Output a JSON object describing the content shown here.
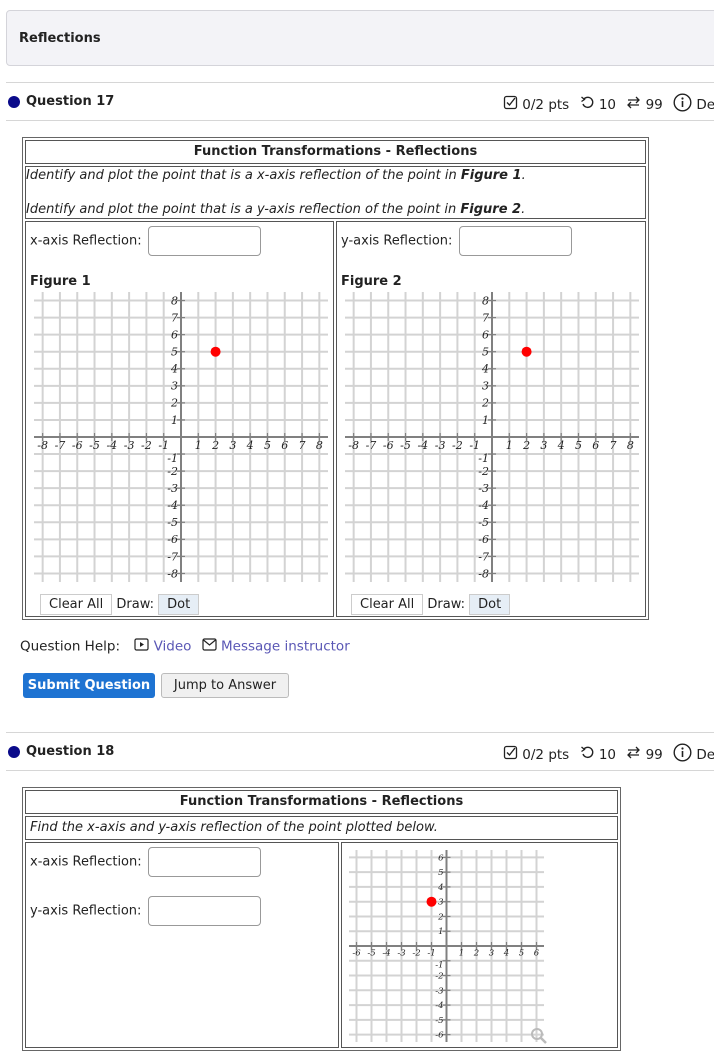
{
  "page": {
    "title": "Reflections"
  },
  "questions": [
    {
      "label": "Question 17",
      "meta": {
        "points": "0/2 pts",
        "retries": "10",
        "attempts": "99",
        "details": "Details"
      },
      "caption": "Function Transformations - Reflections",
      "instructions": [
        {
          "pre": "Identify and plot the point that is a x-axis reflection of the point in ",
          "bold": "Figure 1",
          "post": "."
        },
        {
          "pre": "Identify and plot the point that is a y-axis reflection of the point in ",
          "bold": "Figure 2",
          "post": "."
        }
      ],
      "fields": [
        {
          "label": "x-axis Reflection:",
          "value": ""
        },
        {
          "label": "y-axis Reflection:",
          "value": ""
        }
      ],
      "figures": [
        {
          "label": "Figure 1",
          "clear_label": "Clear All",
          "draw_label": "Draw:",
          "dot_label": "Dot"
        },
        {
          "label": "Figure 2",
          "clear_label": "Clear All",
          "draw_label": "Draw:",
          "dot_label": "Dot"
        }
      ],
      "help": {
        "label": "Question Help:",
        "video": "Video",
        "message": "Message instructor"
      },
      "buttons": {
        "submit": "Submit Question",
        "jump": "Jump to Answer"
      }
    },
    {
      "label": "Question 18",
      "meta": {
        "points": "0/2 pts",
        "retries": "10",
        "attempts": "99",
        "details": "Details"
      },
      "caption": "Function Transformations - Reflections",
      "instructions": [
        {
          "pre": "Find the x-axis and y-axis reflection of the point plotted below.",
          "bold": "",
          "post": ""
        }
      ],
      "fields": [
        {
          "label": "x-axis Reflection:",
          "value": ""
        },
        {
          "label": "y-axis Reflection:",
          "value": ""
        }
      ]
    }
  ],
  "chart_data": [
    {
      "type": "scatter",
      "title": "Figure 1",
      "xlim": [
        -8,
        8
      ],
      "ylim": [
        -8,
        8
      ],
      "grid": true,
      "xticks": [
        -8,
        -7,
        -6,
        -5,
        -4,
        -3,
        -2,
        -1,
        1,
        2,
        3,
        4,
        5,
        6,
        7,
        8
      ],
      "yticks": [
        -8,
        -7,
        -6,
        -5,
        -4,
        -3,
        -2,
        -1,
        1,
        2,
        3,
        4,
        5,
        6,
        7,
        8
      ],
      "points": [
        {
          "x": 2,
          "y": 5,
          "color": "#ff0000"
        }
      ]
    },
    {
      "type": "scatter",
      "title": "Figure 2",
      "xlim": [
        -8,
        8
      ],
      "ylim": [
        -8,
        8
      ],
      "grid": true,
      "xticks": [
        -8,
        -7,
        -6,
        -5,
        -4,
        -3,
        -2,
        -1,
        1,
        2,
        3,
        4,
        5,
        6,
        7,
        8
      ],
      "yticks": [
        -8,
        -7,
        -6,
        -5,
        -4,
        -3,
        -2,
        -1,
        1,
        2,
        3,
        4,
        5,
        6,
        7,
        8
      ],
      "points": [
        {
          "x": 2,
          "y": 5,
          "color": "#ff0000"
        }
      ]
    },
    {
      "type": "scatter",
      "title": "",
      "xlim": [
        -6,
        6
      ],
      "ylim": [
        -6,
        6
      ],
      "grid": true,
      "xticks": [
        -6,
        -5,
        -4,
        -3,
        -2,
        -1,
        1,
        2,
        3,
        4,
        5,
        6
      ],
      "yticks": [
        -6,
        -5,
        -4,
        -3,
        -2,
        -1,
        1,
        2,
        3,
        4,
        5,
        6
      ],
      "points": [
        {
          "x": -1,
          "y": 3,
          "color": "#ff0000"
        }
      ]
    }
  ]
}
